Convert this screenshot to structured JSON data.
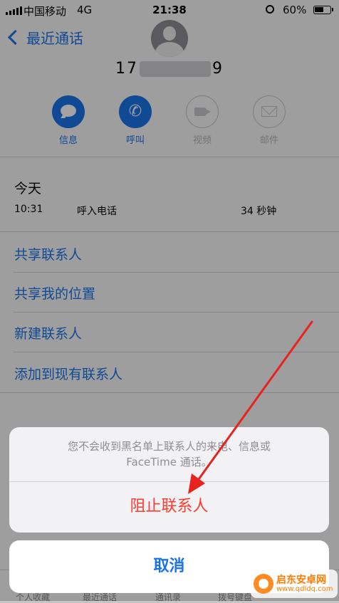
{
  "status_bar": {
    "carrier": "中国移动",
    "network": "4G",
    "time": "21:38",
    "battery": "60%",
    "battery_level": 0.6
  },
  "header": {
    "back_label": "最近通话",
    "phone_prefix": "17",
    "phone_suffix": "9"
  },
  "actions": [
    {
      "label": "信息",
      "icon": "message-icon",
      "enabled": true
    },
    {
      "label": "呼叫",
      "icon": "phone-icon",
      "enabled": true
    },
    {
      "label": "视频",
      "icon": "video-icon",
      "enabled": false
    },
    {
      "label": "邮件",
      "icon": "mail-icon",
      "enabled": false
    }
  ],
  "recent": {
    "day": "今天",
    "time": "10:31",
    "type": "呼入电话",
    "duration": "34 秒钟"
  },
  "menu_items": [
    "共享联系人",
    "共享我的位置",
    "新建联系人",
    "添加到现有联系人"
  ],
  "tabs": [
    "个人收藏",
    "最近通话",
    "通讯录",
    "拨号键盘"
  ],
  "sheet": {
    "message_line1": "您不会收到黑名单上联系人的来电、信息或",
    "message_line2": "FaceTime 通话。",
    "block_label": "阻止联系人",
    "cancel_label": "取消"
  },
  "watermark": {
    "title": "启东安卓网",
    "url": "www.qdldq.com"
  },
  "colors": {
    "accent": "#1a73e8",
    "danger": "#ff3b30",
    "annotation_arrow": "#e8231f"
  }
}
